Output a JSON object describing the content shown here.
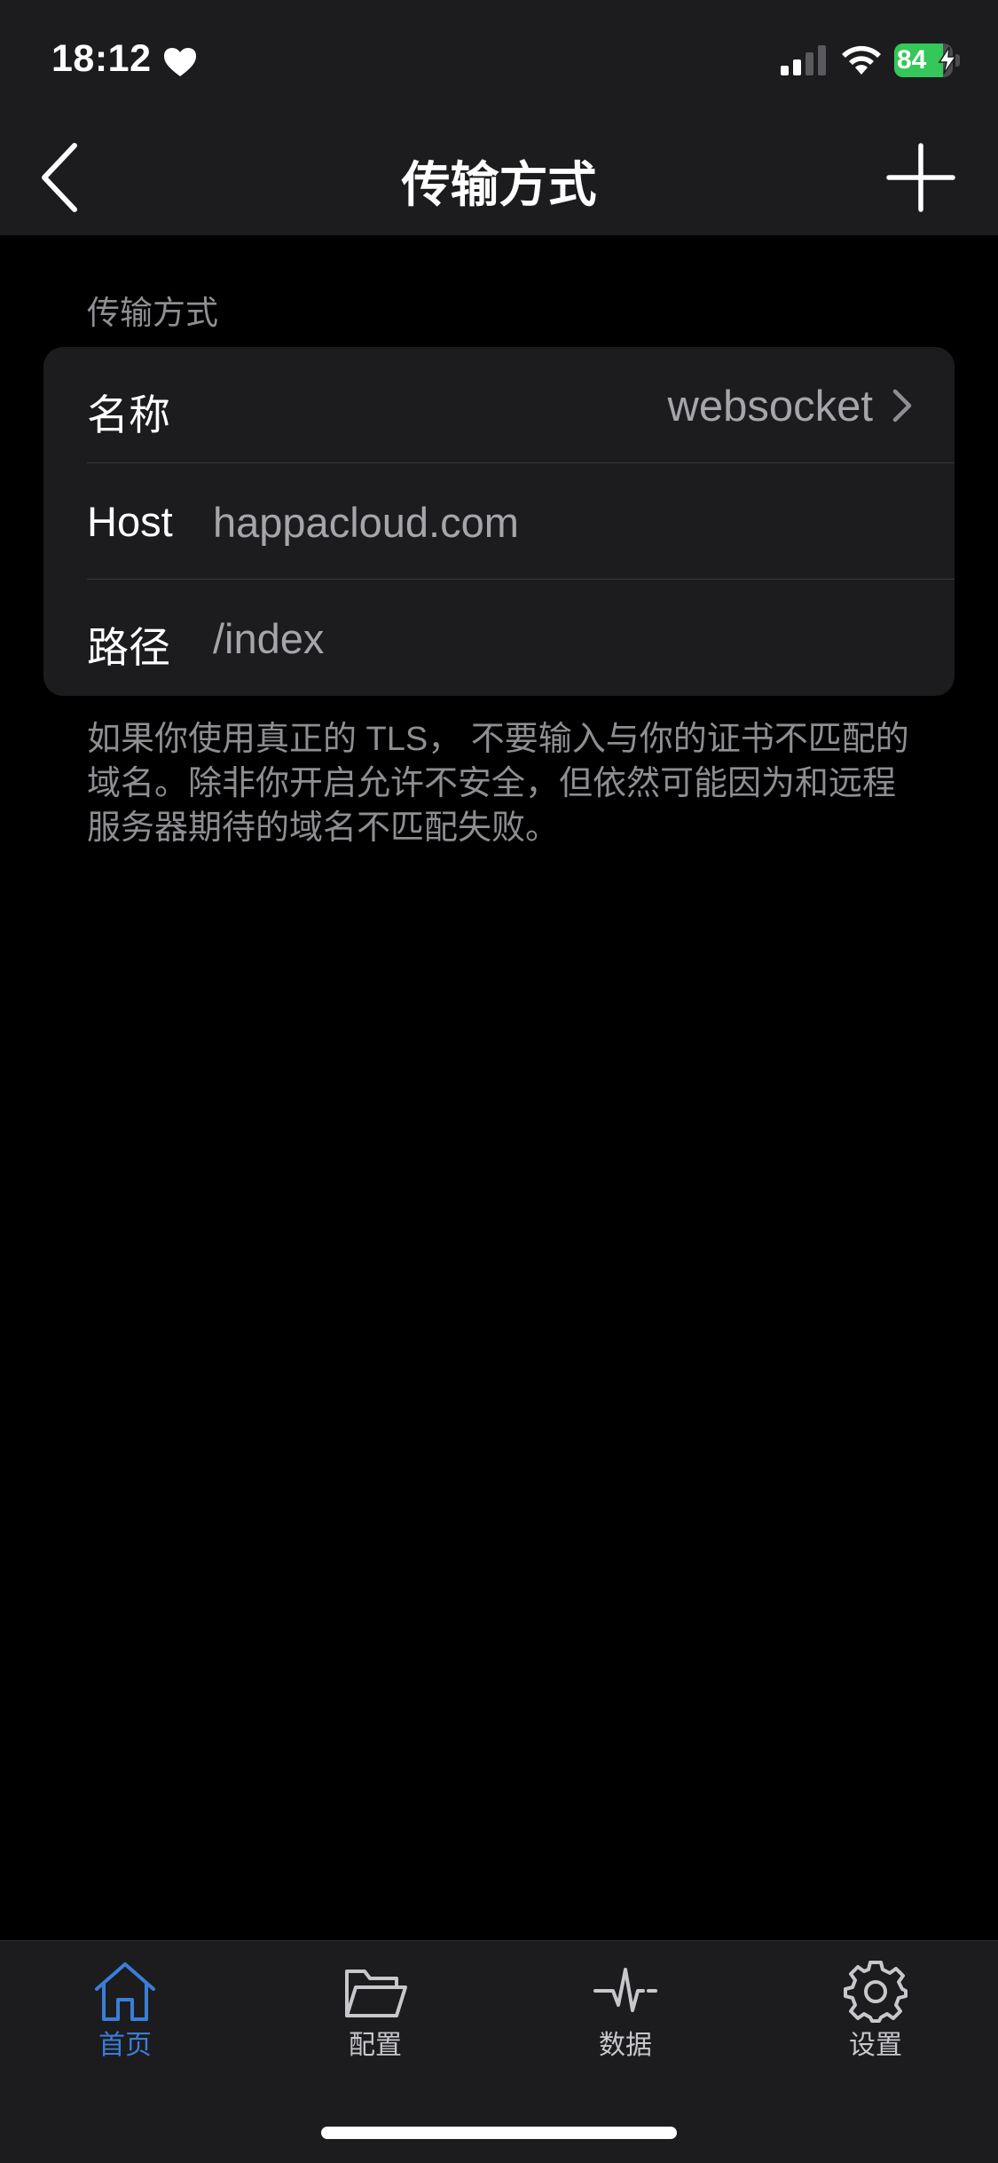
{
  "status_bar": {
    "time": "18:12",
    "battery_percent": "84",
    "battery_level": 0.84
  },
  "nav": {
    "title": "传输方式"
  },
  "section": {
    "header": "传输方式",
    "rows": [
      {
        "label": "名称",
        "value": "websocket"
      },
      {
        "label": "Host",
        "value": "happacloud.com"
      },
      {
        "label": "路径",
        "value": "/index"
      }
    ],
    "footer": "如果你使用真正的 TLS， 不要输入与你的证书不匹配的域名。除非你开启允许不安全，但依然可能因为和远程服务器期待的域名不匹配失败。"
  },
  "tabs": [
    {
      "label": "首页",
      "icon": "home-icon",
      "active": true
    },
    {
      "label": "配置",
      "icon": "folder-icon",
      "active": false
    },
    {
      "label": "数据",
      "icon": "pulse-icon",
      "active": false
    },
    {
      "label": "设置",
      "icon": "gear-icon",
      "active": false
    }
  ],
  "colors": {
    "accent": "#3b7ed8",
    "battery": "#34c759",
    "surface": "#1c1c1e",
    "background": "#000000"
  }
}
